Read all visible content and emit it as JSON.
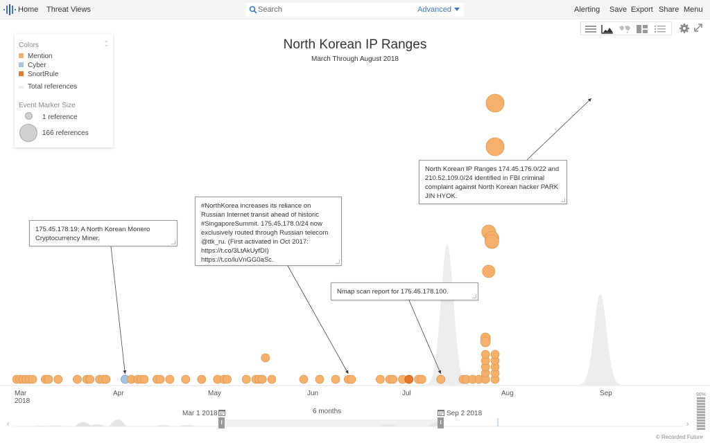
{
  "topbar": {
    "home": "Home",
    "threat_views": "Threat Views",
    "search_placeholder": "Search",
    "advanced": "Advanced",
    "alerting": "Alerting",
    "save": "Save",
    "export": "Export",
    "share": "Share",
    "menu": "Menu"
  },
  "view_toolbar": {
    "buttons": [
      "table-view",
      "timeline-view",
      "map-view",
      "grid-view",
      "list-view"
    ],
    "active": "timeline-view"
  },
  "legend": {
    "colors_header": "Colors",
    "items": [
      {
        "label": "Mention",
        "color": "#f5b06b"
      },
      {
        "label": "Cyber",
        "color": "#a8c4e0"
      },
      {
        "label": "SnortRule",
        "color": "#e8772a"
      }
    ],
    "total_refs": "Total references",
    "size_header": "Event Marker Size",
    "size_small": "1 reference",
    "size_large": "166 references"
  },
  "chart_data": {
    "type": "scatter",
    "title": "North Korean IP Ranges",
    "subtitle": "March Through August 2018",
    "x_ticks": [
      {
        "label": "Mar",
        "sub": "2018",
        "date": "2018-03-01"
      },
      {
        "label": "Apr",
        "sub": "",
        "date": "2018-04-01"
      },
      {
        "label": "May",
        "sub": "",
        "date": "2018-05-01"
      },
      {
        "label": "Jun",
        "sub": "",
        "date": "2018-06-01"
      },
      {
        "label": "Jul",
        "sub": "",
        "date": "2018-07-01"
      },
      {
        "label": "Aug",
        "sub": "",
        "date": "2018-08-01"
      },
      {
        "label": "Sep",
        "sub": "",
        "date": "2018-09-01"
      }
    ],
    "xlim": [
      "2018-03-01",
      "2018-09-02"
    ],
    "series": [
      {
        "name": "Mention",
        "color": "#f5b06b"
      },
      {
        "name": "Cyber",
        "color": "#a8c4e0"
      },
      {
        "name": "SnortRule",
        "color": "#e8772a"
      }
    ],
    "events": [
      {
        "day": 0,
        "level": 0,
        "type": "Mention"
      },
      {
        "day": 1,
        "level": 0,
        "type": "Mention"
      },
      {
        "day": 2,
        "level": 0,
        "type": "Mention"
      },
      {
        "day": 3,
        "level": 0,
        "type": "Mention"
      },
      {
        "day": 4,
        "level": 0,
        "type": "Mention"
      },
      {
        "day": 5,
        "level": 0,
        "type": "Mention"
      },
      {
        "day": 9,
        "level": 0,
        "type": "Mention"
      },
      {
        "day": 10,
        "level": 0,
        "type": "Mention"
      },
      {
        "day": 13,
        "level": 0,
        "type": "Mention"
      },
      {
        "day": 19,
        "level": 0,
        "type": "Mention"
      },
      {
        "day": 22,
        "level": 0,
        "type": "Mention"
      },
      {
        "day": 23,
        "level": 0,
        "type": "Mention"
      },
      {
        "day": 26,
        "level": 0,
        "type": "Mention"
      },
      {
        "day": 27,
        "level": 0,
        "type": "Mention"
      },
      {
        "day": 28,
        "level": 0,
        "type": "Mention"
      },
      {
        "day": 34,
        "level": 0,
        "type": "Cyber"
      },
      {
        "day": 36,
        "level": 0,
        "type": "Mention"
      },
      {
        "day": 38,
        "level": 0,
        "type": "Mention"
      },
      {
        "day": 39,
        "level": 0,
        "type": "Mention"
      },
      {
        "day": 40,
        "level": 0,
        "type": "Mention"
      },
      {
        "day": 44,
        "level": 0,
        "type": "Mention"
      },
      {
        "day": 45,
        "level": 0,
        "type": "Mention"
      },
      {
        "day": 48,
        "level": 0,
        "type": "Mention"
      },
      {
        "day": 53,
        "level": 0,
        "type": "Mention"
      },
      {
        "day": 58,
        "level": 0,
        "type": "Mention"
      },
      {
        "day": 63,
        "level": 0,
        "type": "Mention"
      },
      {
        "day": 65,
        "level": 0,
        "type": "Mention"
      },
      {
        "day": 66,
        "level": 0,
        "type": "Mention"
      },
      {
        "day": 72,
        "level": 0,
        "type": "Mention"
      },
      {
        "day": 75,
        "level": 0,
        "type": "Mention"
      },
      {
        "day": 76,
        "level": 0,
        "type": "Mention"
      },
      {
        "day": 77,
        "level": 0,
        "type": "Mention"
      },
      {
        "day": 78,
        "level": 2,
        "type": "Mention"
      },
      {
        "day": 80,
        "level": 0,
        "type": "Mention"
      },
      {
        "day": 90,
        "level": 0,
        "type": "Mention"
      },
      {
        "day": 95,
        "level": 0,
        "type": "Mention"
      },
      {
        "day": 100,
        "level": 0,
        "type": "Mention"
      },
      {
        "day": 104,
        "level": 0,
        "type": "Mention"
      },
      {
        "day": 105,
        "level": 0,
        "type": "Mention"
      },
      {
        "day": 114,
        "level": 0,
        "type": "Mention"
      },
      {
        "day": 117,
        "level": 0,
        "type": "Mention"
      },
      {
        "day": 118,
        "level": 0,
        "type": "Mention"
      },
      {
        "day": 121,
        "level": 0,
        "type": "Mention"
      },
      {
        "day": 123,
        "level": 0,
        "type": "SnortRule"
      },
      {
        "day": 126,
        "level": 0,
        "type": "Mention"
      },
      {
        "day": 127,
        "level": 0,
        "type": "Mention"
      },
      {
        "day": 133,
        "level": 0,
        "type": "Mention"
      },
      {
        "day": 140,
        "level": 0,
        "type": "Mention"
      },
      {
        "day": 141,
        "level": 0,
        "type": "Mention"
      },
      {
        "day": 143,
        "level": 0,
        "type": "Mention"
      },
      {
        "day": 145,
        "level": 0,
        "type": "Mention"
      },
      {
        "day": 147,
        "level": 0,
        "type": "Mention"
      },
      {
        "day": 147,
        "level": 1,
        "type": "Mention"
      },
      {
        "day": 147,
        "level": 2,
        "type": "Mention"
      },
      {
        "day": 147,
        "level": 3,
        "type": "Mention"
      },
      {
        "day": 147,
        "level": 4,
        "type": "Mention"
      },
      {
        "day": 150,
        "level": 0,
        "type": "Mention"
      },
      {
        "day": 150,
        "level": 1,
        "type": "Mention"
      },
      {
        "day": 150,
        "level": 2,
        "type": "Mention"
      },
      {
        "day": 150,
        "level": 3,
        "type": "Mention"
      },
      {
        "day": 150,
        "level": 4,
        "type": "Mention"
      },
      {
        "day": 148,
        "level": 8,
        "big": true,
        "type": "Mention"
      },
      {
        "day": 149,
        "level": 10,
        "big": true,
        "type": "Mention"
      },
      {
        "day": 148,
        "level": 13,
        "big": true,
        "type": "Mention"
      },
      {
        "day": 149,
        "level": 14,
        "big": true,
        "type": "Mention"
      },
      {
        "day": 149,
        "level": 15,
        "big": true,
        "type": "Mention"
      },
      {
        "day": 150,
        "level": 18,
        "big": true,
        "type": "Mention"
      },
      {
        "day": 150,
        "level": 20,
        "big": true,
        "type": "Mention"
      }
    ],
    "total_references_peaks": [
      {
        "date": "2018-07-14",
        "relative_height": 0.85
      },
      {
        "date": "2018-08-31",
        "relative_height": 0.55
      }
    ],
    "annotations": [
      {
        "text": "175.45.178.19; A North Korean Monero Cryptocurrency Miner.",
        "target_day": 34
      },
      {
        "text": "#NorthKorea increases its reliance on Russian Internet transit ahead of historic #SingaporeSummit. 175.45.178.0/24 now exclusively routed through Russian telecom @ttk_ru. (First activated in Oct 2017: https://t.co/3LtAkUyfDI) https://t.co/luVnGG0aSc.",
        "target_day": 104
      },
      {
        "text": "Nmap scan report for 175.45.178.100.",
        "target_day": 133
      },
      {
        "text": "North Korean IP Ranges 174.45.176.0/22 and 210.52.109.0/24 identified in FBI criminal complaint against North Korean hacker PARK JIN HYOK.",
        "target_day": 150
      }
    ]
  },
  "range_selector": {
    "start": "Mar 1 2018",
    "end": "Sep 2 2018",
    "span": "6 months",
    "zoom_pct": "96%"
  },
  "footer": {
    "copyright": "© Recorded Future"
  }
}
